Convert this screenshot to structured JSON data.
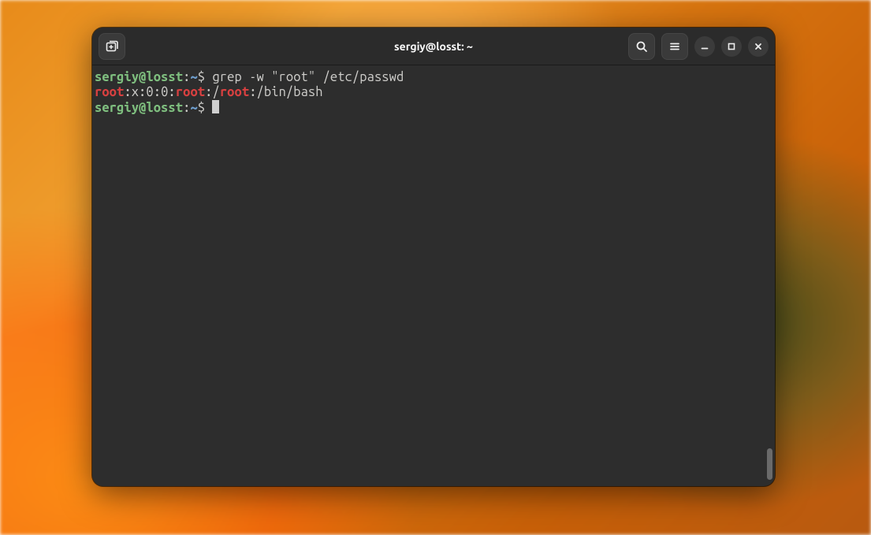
{
  "window": {
    "title": "sergiy@losst: ~"
  },
  "titlebar": {
    "new_tab_label": "New Tab",
    "search_label": "Search",
    "menu_label": "Menu",
    "minimize_label": "Minimize",
    "maximize_label": "Maximize",
    "close_label": "Close"
  },
  "terminal": {
    "prompt_user_host": "sergiy@losst",
    "prompt_separator": ":",
    "prompt_cwd": "~",
    "prompt_symbol": "$",
    "lines": [
      {
        "type": "command",
        "command_text": "grep -w \"root\" /etc/passwd"
      },
      {
        "type": "output",
        "segments": [
          {
            "text": "root",
            "highlight": true
          },
          {
            "text": ":x:0:0:"
          },
          {
            "text": "root",
            "highlight": true
          },
          {
            "text": ":/"
          },
          {
            "text": "root",
            "highlight": true
          },
          {
            "text": ":/bin/bash"
          }
        ]
      },
      {
        "type": "prompt"
      }
    ]
  },
  "colors": {
    "bg_window": "#1e1e1e",
    "bg_terminal": "#2d2d2d",
    "bg_titlebar": "#2b2b2b",
    "prompt_green": "#7fbf7f",
    "prompt_blue": "#6f9fcf",
    "match_red": "#d84040",
    "text_default": "#d0cfcc"
  }
}
